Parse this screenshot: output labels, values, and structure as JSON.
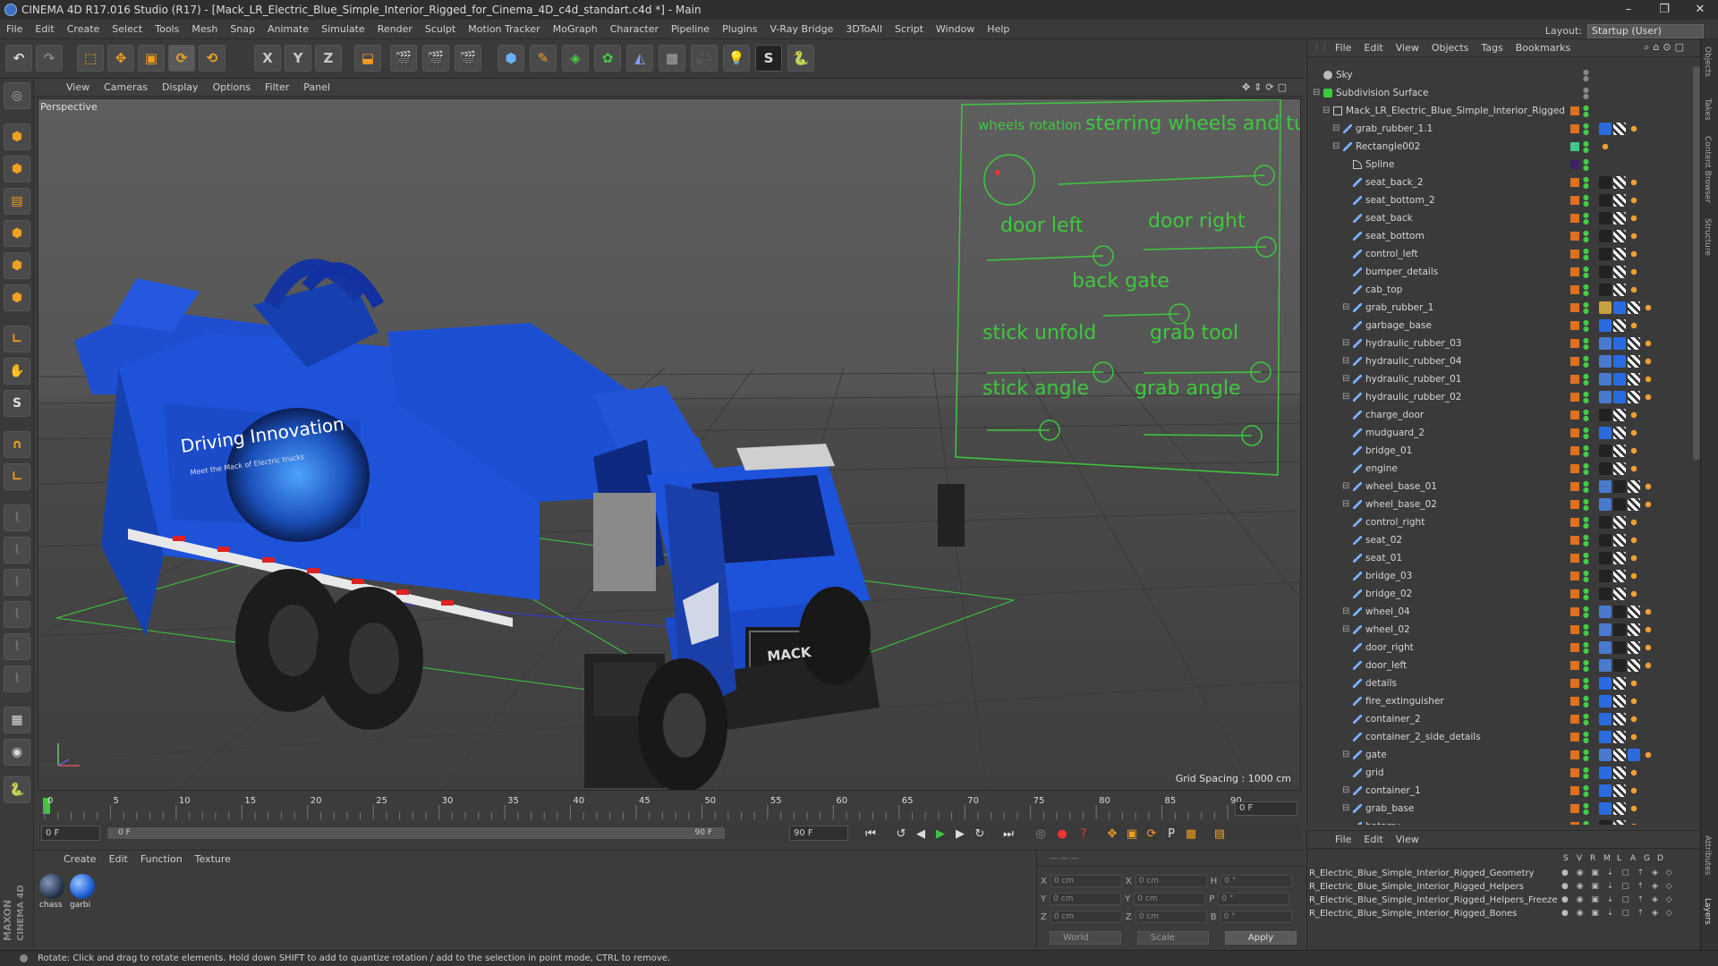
{
  "title": "CINEMA 4D R17.016 Studio (R17) - [Mack_LR_Electric_Blue_Simple_Interior_Rigged_for_Cinema_4D_c4d_standart.c4d *] - Main",
  "window_buttons": [
    "–",
    "❐",
    "✕"
  ],
  "menu": [
    "File",
    "Edit",
    "Create",
    "Select",
    "Tools",
    "Mesh",
    "Snap",
    "Animate",
    "Simulate",
    "Render",
    "Sculpt",
    "Motion Tracker",
    "MoGraph",
    "Character",
    "Pipeline",
    "Plugins",
    "V-Ray Bridge",
    "3DToAll",
    "Script",
    "Window",
    "Help"
  ],
  "layout": {
    "label": "Layout:",
    "value": "Startup (User)"
  },
  "toolbar_axes": [
    "X",
    "Y",
    "Z"
  ],
  "viewport": {
    "menu": [
      "View",
      "Cameras",
      "Display",
      "Options",
      "Filter",
      "Panel"
    ],
    "label": "Perspective",
    "grid_spacing": "Grid Spacing : 1000 cm",
    "truck_text": {
      "brand": "Driving Innovation",
      "sub": "Meet the Mack of Electric trucks",
      "grille": "MACK"
    },
    "rig_labels": {
      "wheels_rotation": "wheels rotation",
      "steering": "sterring wheels and turns",
      "door_left": "door left",
      "door_right": "door right",
      "back_gate": "back gate",
      "stick_unfold": "stick unfold",
      "grab_tool": "grab tool",
      "stick_angle": "stick angle",
      "grab_angle": "grab angle"
    }
  },
  "timeline": {
    "ticks": [
      "0",
      "5",
      "10",
      "15",
      "20",
      "25",
      "30",
      "35",
      "40",
      "45",
      "50",
      "55",
      "60",
      "65",
      "70",
      "75",
      "80",
      "85",
      "90"
    ],
    "end_frame": "0 F",
    "start_field": "0 F",
    "range_start": "0 F",
    "range_end": "90 F",
    "end_field": "90 F"
  },
  "material_panel": {
    "menu": [
      "Create",
      "Edit",
      "Function",
      "Texture"
    ],
    "materials": [
      {
        "name": "chass",
        "color": "#2a3a55"
      },
      {
        "name": "garbi",
        "color": "#1d5fd6"
      }
    ]
  },
  "coords": {
    "rows": [
      {
        "axis": "X",
        "pos": "0 cm",
        "axis2": "X",
        "size": "0 cm",
        "axis3": "H",
        "rot": "0 °"
      },
      {
        "axis": "Y",
        "pos": "0 cm",
        "axis2": "Y",
        "size": "0 cm",
        "axis3": "P",
        "rot": "0 °"
      },
      {
        "axis": "Z",
        "pos": "0 cm",
        "axis2": "Z",
        "size": "0 cm",
        "axis3": "B",
        "rot": "0 °"
      }
    ],
    "mode": "World",
    "scale": "Scale",
    "apply": "Apply"
  },
  "object_manager": {
    "menu": [
      "File",
      "Edit",
      "View",
      "Objects",
      "Tags",
      "Bookmarks"
    ],
    "objects": [
      {
        "name": "Sky",
        "indent": 0,
        "expand": false,
        "icon": "sky",
        "layer": "none",
        "tags": []
      },
      {
        "name": "Subdivision Surface",
        "indent": 0,
        "expand": true,
        "icon": "subdiv",
        "layer": "none",
        "tags": []
      },
      {
        "name": "Mack_LR_Electric_Blue_Simple_Interior_Rigged",
        "indent": 1,
        "expand": true,
        "icon": "null",
        "layer": "orange",
        "tags": []
      },
      {
        "name": "grab_rubber_1.1",
        "indent": 2,
        "expand": true,
        "icon": "bone",
        "layer": "orange",
        "tags": [
          "#2a6be0",
          "#bbb",
          "#e08020"
        ]
      },
      {
        "name": "Rectangle002",
        "indent": 2,
        "expand": true,
        "icon": "bone",
        "layer": "green",
        "tags": [
          "#e08020"
        ]
      },
      {
        "name": "Spline",
        "indent": 3,
        "expand": false,
        "icon": "spline",
        "layer": "purple",
        "tags": []
      },
      {
        "name": "seat_back_2",
        "indent": 3,
        "expand": false,
        "icon": "bone",
        "layer": "orange",
        "tags": [
          "#222",
          "#bbb",
          "#e08020"
        ]
      },
      {
        "name": "seat_bottom_2",
        "indent": 3,
        "expand": false,
        "icon": "bone",
        "layer": "orange",
        "tags": [
          "#222",
          "#bbb",
          "#e08020"
        ]
      },
      {
        "name": "seat_back",
        "indent": 3,
        "expand": false,
        "icon": "bone",
        "layer": "orange",
        "tags": [
          "#222",
          "#bbb",
          "#e08020"
        ]
      },
      {
        "name": "seat_bottom",
        "indent": 3,
        "expand": false,
        "icon": "bone",
        "layer": "orange",
        "tags": [
          "#222",
          "#bbb",
          "#e08020"
        ]
      },
      {
        "name": "control_left",
        "indent": 3,
        "expand": false,
        "icon": "bone",
        "layer": "orange",
        "tags": [
          "#222",
          "#bbb",
          "#e08020"
        ]
      },
      {
        "name": "bumper_details",
        "indent": 3,
        "expand": false,
        "icon": "bone",
        "layer": "orange",
        "tags": [
          "#222",
          "#bbb",
          "#e08020"
        ]
      },
      {
        "name": "cab_top",
        "indent": 3,
        "expand": false,
        "icon": "bone",
        "layer": "orange",
        "tags": [
          "#222",
          "#bbb",
          "#e08020"
        ]
      },
      {
        "name": "grab_rubber_1",
        "indent": 3,
        "expand": true,
        "icon": "bone",
        "layer": "orange",
        "tags": [
          "#c9a040",
          "#2a6be0",
          "#bbb",
          "#e08020"
        ]
      },
      {
        "name": "garbage_base",
        "indent": 3,
        "expand": false,
        "icon": "bone",
        "layer": "orange",
        "tags": [
          "#2a6be0",
          "#bbb",
          "#e08020"
        ]
      },
      {
        "name": "hydraulic_rubber_03",
        "indent": 3,
        "expand": true,
        "icon": "bone",
        "layer": "orange",
        "tags": [
          "#4a7ad0",
          "#2a6be0",
          "#bbb",
          "#e08020"
        ]
      },
      {
        "name": "hydraulic_rubber_04",
        "indent": 3,
        "expand": true,
        "icon": "bone",
        "layer": "orange",
        "tags": [
          "#4a7ad0",
          "#2a6be0",
          "#bbb",
          "#e08020"
        ]
      },
      {
        "name": "hydraulic_rubber_01",
        "indent": 3,
        "expand": true,
        "icon": "bone",
        "layer": "orange",
        "tags": [
          "#4a7ad0",
          "#2a6be0",
          "#bbb",
          "#e08020"
        ]
      },
      {
        "name": "hydraulic_rubber_02",
        "indent": 3,
        "expand": true,
        "icon": "bone",
        "layer": "orange",
        "tags": [
          "#4a7ad0",
          "#2a6be0",
          "#bbb",
          "#e08020"
        ]
      },
      {
        "name": "charge_door",
        "indent": 3,
        "expand": false,
        "icon": "bone",
        "layer": "orange",
        "tags": [
          "#222",
          "#bbb",
          "#e08020"
        ]
      },
      {
        "name": "mudguard_2",
        "indent": 3,
        "expand": false,
        "icon": "bone",
        "layer": "orange",
        "tags": [
          "#2a6be0",
          "#bbb",
          "#e08020"
        ]
      },
      {
        "name": "bridge_01",
        "indent": 3,
        "expand": false,
        "icon": "bone",
        "layer": "orange",
        "tags": [
          "#222",
          "#bbb",
          "#e08020"
        ]
      },
      {
        "name": "engine",
        "indent": 3,
        "expand": false,
        "icon": "bone",
        "layer": "orange",
        "tags": [
          "#222",
          "#bbb",
          "#e08020"
        ]
      },
      {
        "name": "wheel_base_01",
        "indent": 3,
        "expand": true,
        "icon": "bone",
        "layer": "orange",
        "tags": [
          "#4a7ad0",
          "#222",
          "#bbb",
          "#e08020"
        ]
      },
      {
        "name": "wheel_base_02",
        "indent": 3,
        "expand": true,
        "icon": "bone",
        "layer": "orange",
        "tags": [
          "#4a7ad0",
          "#222",
          "#bbb",
          "#e08020"
        ]
      },
      {
        "name": "control_right",
        "indent": 3,
        "expand": false,
        "icon": "bone",
        "layer": "orange",
        "tags": [
          "#222",
          "#bbb",
          "#e08020"
        ]
      },
      {
        "name": "seat_02",
        "indent": 3,
        "expand": false,
        "icon": "bone",
        "layer": "orange",
        "tags": [
          "#222",
          "#bbb",
          "#e08020"
        ]
      },
      {
        "name": "seat_01",
        "indent": 3,
        "expand": false,
        "icon": "bone",
        "layer": "orange",
        "tags": [
          "#222",
          "#bbb",
          "#e08020"
        ]
      },
      {
        "name": "bridge_03",
        "indent": 3,
        "expand": false,
        "icon": "bone",
        "layer": "orange",
        "tags": [
          "#222",
          "#bbb",
          "#e08020"
        ]
      },
      {
        "name": "bridge_02",
        "indent": 3,
        "expand": false,
        "icon": "bone",
        "layer": "orange",
        "tags": [
          "#222",
          "#bbb",
          "#e08020"
        ]
      },
      {
        "name": "wheel_04",
        "indent": 3,
        "expand": true,
        "icon": "bone",
        "layer": "orange",
        "tags": [
          "#4a7ad0",
          "#222",
          "#bbb",
          "#e08020"
        ]
      },
      {
        "name": "wheel_02",
        "indent": 3,
        "expand": true,
        "icon": "bone",
        "layer": "orange",
        "tags": [
          "#4a7ad0",
          "#222",
          "#bbb",
          "#e08020"
        ]
      },
      {
        "name": "door_right",
        "indent": 3,
        "expand": false,
        "icon": "bone",
        "layer": "orange",
        "tags": [
          "#4a7ad0",
          "#222",
          "#bbb",
          "#e08020"
        ]
      },
      {
        "name": "door_left",
        "indent": 3,
        "expand": false,
        "icon": "bone",
        "layer": "orange",
        "tags": [
          "#4a7ad0",
          "#222",
          "#bbb",
          "#e08020"
        ]
      },
      {
        "name": "details",
        "indent": 3,
        "expand": false,
        "icon": "bone",
        "layer": "orange",
        "tags": [
          "#2a6be0",
          "#bbb",
          "#e08020"
        ]
      },
      {
        "name": "fire_extinguisher",
        "indent": 3,
        "expand": false,
        "icon": "bone",
        "layer": "orange",
        "tags": [
          "#2a6be0",
          "#bbb",
          "#e08020"
        ]
      },
      {
        "name": "container_2",
        "indent": 3,
        "expand": false,
        "icon": "bone",
        "layer": "orange",
        "tags": [
          "#2a6be0",
          "#bbb",
          "#e08020"
        ]
      },
      {
        "name": "container_2_side_details",
        "indent": 3,
        "expand": false,
        "icon": "bone",
        "layer": "orange",
        "tags": [
          "#2a6be0",
          "#bbb",
          "#e08020"
        ]
      },
      {
        "name": "gate",
        "indent": 3,
        "expand": true,
        "icon": "bone",
        "layer": "orange",
        "tags": [
          "#4a7ad0",
          "#bbb",
          "#2a6be0",
          "#e08020"
        ]
      },
      {
        "name": "grid",
        "indent": 3,
        "expand": false,
        "icon": "bone",
        "layer": "orange",
        "tags": [
          "#2a6be0",
          "#bbb",
          "#e08020"
        ]
      },
      {
        "name": "container_1",
        "indent": 3,
        "expand": true,
        "icon": "bone",
        "layer": "orange",
        "tags": [
          "#2a6be0",
          "#bbb",
          "#e08020"
        ]
      },
      {
        "name": "grab_base",
        "indent": 3,
        "expand": true,
        "icon": "bone",
        "layer": "orange",
        "tags": [
          "#2a6be0",
          "#bbb",
          "#e08020"
        ]
      },
      {
        "name": "batarry",
        "indent": 3,
        "expand": false,
        "icon": "bone",
        "layer": "orange",
        "tags": [
          "#222",
          "#bbb",
          "#e08020"
        ]
      }
    ]
  },
  "layer_manager": {
    "menu": [
      "File",
      "Edit",
      "View"
    ],
    "columns": [
      "S",
      "V",
      "R",
      "M",
      "L",
      "A",
      "G",
      "D"
    ],
    "layers": [
      "R_Electric_Blue_Simple_Interior_Rigged_Geometry",
      "R_Electric_Blue_Simple_Interior_Rigged_Helpers",
      "R_Electric_Blue_Simple_Interior_Rigged_Helpers_Freeze",
      "R_Electric_Blue_Simple_Interior_Rigged_Bones"
    ]
  },
  "right_tabs": [
    "Objects",
    "Takes",
    "Content Browser",
    "Structure",
    "Attributes",
    "Layers"
  ],
  "maxon": {
    "top": "MAXON",
    "bottom": "CINEMA 4D"
  },
  "status": "Rotate: Click and drag to rotate elements. Hold down SHIFT to add to quantize rotation / add to the selection in point mode, CTRL to remove."
}
